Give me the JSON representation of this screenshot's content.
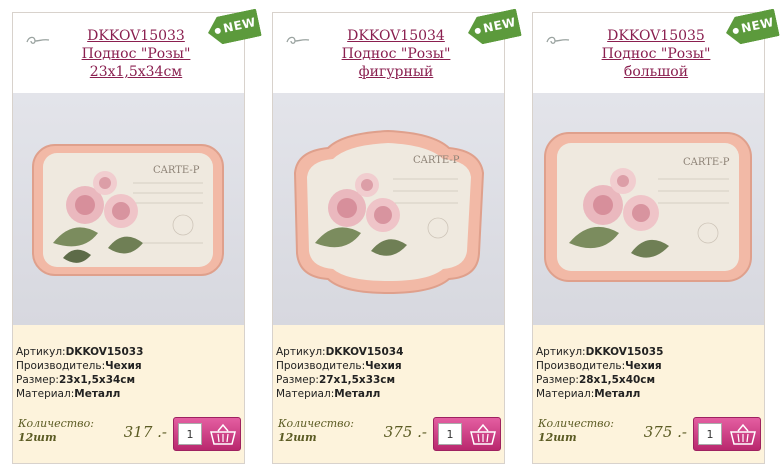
{
  "products": [
    {
      "sku": "DKKOV15033",
      "name_line1": "Поднос \"Розы\"",
      "name_line2": "23x1,5x34см",
      "badge": "NEW",
      "specs": {
        "article_label": "Артикул:",
        "article_value": "DKKOV15033",
        "maker_label": "Производитель:",
        "maker_value": "Чехия",
        "size_label": "Размер:",
        "size_value": "23x1,5x34см",
        "material_label": "Материал:",
        "material_value": "Металл"
      },
      "qty_label": "Количество:",
      "qty_unit": "12шт",
      "price": "317 .-",
      "qty_value": "1",
      "shape": "rect"
    },
    {
      "sku": "DKKOV15034",
      "name_line1": "Поднос \"Розы\"",
      "name_line2": "фигурный",
      "badge": "NEW",
      "specs": {
        "article_label": "Артикул:",
        "article_value": "DKKOV15034",
        "maker_label": "Производитель:",
        "maker_value": "Чехия",
        "size_label": "Размер:",
        "size_value": "27x1,5x33см",
        "material_label": "Материал:",
        "material_value": "Металл"
      },
      "qty_label": "Количество:",
      "qty_unit": "12шт",
      "price": "375 .-",
      "qty_value": "1",
      "shape": "shaped"
    },
    {
      "sku": "DKKOV15035",
      "name_line1": "Поднос \"Розы\"",
      "name_line2": "большой",
      "badge": "NEW",
      "specs": {
        "article_label": "Артикул:",
        "article_value": "DKKOV15035",
        "maker_label": "Производитель:",
        "maker_value": "Чехия",
        "size_label": "Размер:",
        "size_value": "28x1,5x40см",
        "material_label": "Материал:",
        "material_value": "Металл"
      },
      "qty_label": "Количество:",
      "qty_unit": "12шт",
      "price": "375 .-",
      "qty_value": "1",
      "shape": "rect"
    }
  ],
  "tray_print_text": "CARTE-P",
  "colors": {
    "title": "#8a1f4f",
    "badge_green": "#5c9a3c",
    "info_bg": "#fdf3dc",
    "cart_pink": "#d1438a",
    "tray_rim": "#f2b9a6"
  },
  "icons": [
    "swirl-ornament-icon",
    "new-tag-icon",
    "shopping-basket-icon"
  ]
}
